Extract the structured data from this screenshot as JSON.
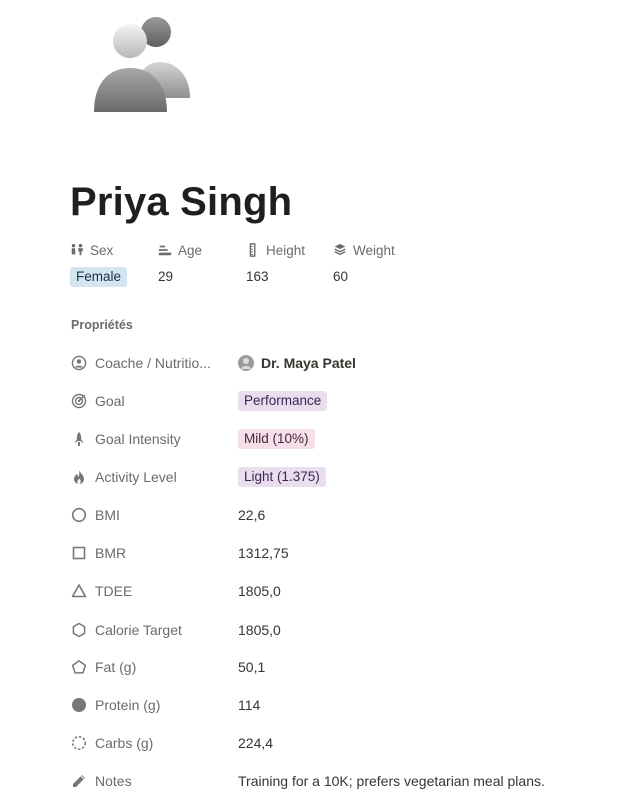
{
  "page": {
    "title": "Priya Singh",
    "avatar_icon": "people-avatar-icon"
  },
  "quick_props": [
    {
      "label": "Sex",
      "icon": "sex-icon",
      "value": "Female",
      "style": "pill-blue"
    },
    {
      "label": "Age",
      "icon": "age-icon",
      "value": "29"
    },
    {
      "label": "Height",
      "icon": "ruler-icon",
      "value": "163"
    },
    {
      "label": "Weight",
      "icon": "weight-icon",
      "value": "60"
    }
  ],
  "section_title": "Propriétés",
  "properties": [
    {
      "label": "Coache / Nutritio...",
      "icon": "person-circle-icon",
      "value": "Dr. Maya Patel",
      "type": "person"
    },
    {
      "label": "Goal",
      "icon": "target-icon",
      "value": "Performance",
      "type": "pill-purple"
    },
    {
      "label": "Goal Intensity",
      "icon": "rocket-icon",
      "value": "Mild (10%)",
      "type": "pill-red"
    },
    {
      "label": "Activity Level",
      "icon": "flame-icon",
      "value": "Light (1.375)",
      "type": "pill-purple"
    },
    {
      "label": "BMI",
      "icon": "circle-outline-icon",
      "value": "22,6"
    },
    {
      "label": "BMR",
      "icon": "square-outline-icon",
      "value": "1312,75"
    },
    {
      "label": "TDEE",
      "icon": "triangle-outline-icon",
      "value": "1805,0"
    },
    {
      "label": "Calorie Target",
      "icon": "hexagon-outline-icon",
      "value": "1805,0"
    },
    {
      "label": "Fat (g)",
      "icon": "pentagon-outline-icon",
      "value": "50,1"
    },
    {
      "label": "Protein (g)",
      "icon": "filled-circle-icon",
      "value": "114"
    },
    {
      "label": "Carbs (g)",
      "icon": "dashed-circle-icon",
      "value": "224,4"
    },
    {
      "label": "Notes",
      "icon": "pencil-icon",
      "value": "Training for a 10K; prefers vegetarian meal plans."
    }
  ],
  "colors": {
    "pill_blue_bg": "#d3e5ef",
    "pill_purple_bg": "#e8deee",
    "pill_red_bg": "#f5e0e9",
    "label_gray": "#6b6b6b",
    "text": "#37352f"
  }
}
